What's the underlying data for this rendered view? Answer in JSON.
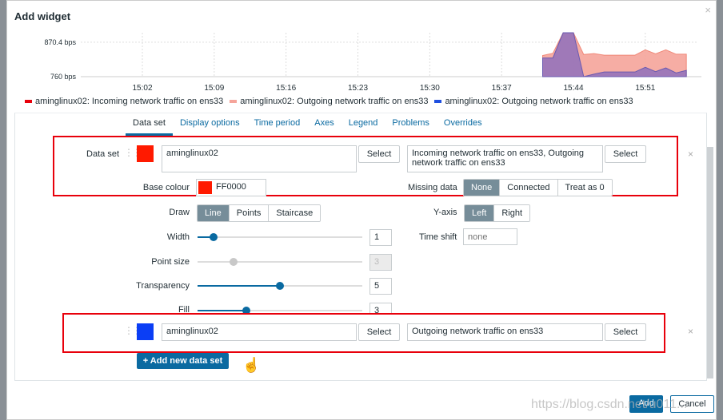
{
  "dialog": {
    "title": "Add widget",
    "close_icon": "close-icon"
  },
  "chart_data": {
    "type": "area",
    "y_ticks": [
      "870.4 bps",
      "760 bps"
    ],
    "x_ticks": [
      "15:02",
      "15:09",
      "15:16",
      "15:23",
      "15:30",
      "15:37",
      "15:44",
      "15:51"
    ],
    "ylim": [
      760,
      901
    ],
    "xlim": [
      "14:56",
      "15:56"
    ],
    "grid": true,
    "legend_placement": "bottom",
    "series": [
      {
        "name": "aminglinux02: Outgoing network traffic on ens33",
        "color": "#f5a49a",
        "x": [
          "15:41",
          "15:42",
          "15:43",
          "15:44",
          "15:45",
          "15:46",
          "15:47",
          "15:48",
          "15:49",
          "15:50",
          "15:51",
          "15:52",
          "15:53",
          "15:54",
          "15:55"
        ],
        "values": [
          828,
          835,
          901,
          901,
          831,
          834,
          829,
          829,
          829,
          829,
          846,
          833,
          846,
          832,
          832
        ]
      },
      {
        "name": "aminglinux02: Outgoing network traffic on ens33",
        "color": "#8a6bbd",
        "x": [
          "15:41",
          "15:42",
          "15:43",
          "15:44",
          "15:45",
          "15:46",
          "15:47",
          "15:48",
          "15:49",
          "15:50",
          "15:51",
          "15:52",
          "15:53",
          "15:54",
          "15:55"
        ],
        "values": [
          820,
          820,
          901,
          901,
          760,
          768,
          775,
          775,
          775,
          775,
          790,
          776,
          788,
          772,
          780
        ]
      }
    ],
    "legend": [
      {
        "label": "aminglinux02: Incoming network traffic on ens33",
        "color": "#e8000b"
      },
      {
        "label": "aminglinux02: Outgoing network traffic on ens33",
        "color": "#f5a49a"
      },
      {
        "label": "aminglinux02: Outgoing network traffic on ens33",
        "color": "#1f4fe0"
      }
    ]
  },
  "tabs": [
    "Data set",
    "Display options",
    "Time period",
    "Axes",
    "Legend",
    "Problems",
    "Overrides"
  ],
  "dataset1": {
    "label": "Data set",
    "color": "#ff1a00",
    "host": "aminglinux02",
    "select": "Select",
    "items": "Incoming network traffic on ens33, Outgoing network traffic on ens33",
    "base_colour_label": "Base colour",
    "base_colour": "FF0000",
    "missing_label": "Missing data",
    "missing_options": [
      "None",
      "Connected",
      "Treat as 0"
    ],
    "missing_selected": "None"
  },
  "options": {
    "draw_label": "Draw",
    "draw_options": [
      "Line",
      "Points",
      "Staircase"
    ],
    "draw_selected": "Line",
    "yaxis_label": "Y-axis",
    "yaxis_options": [
      "Left",
      "Right"
    ],
    "yaxis_selected": "Left",
    "width_label": "Width",
    "width": "1",
    "timeshift_label": "Time shift",
    "timeshift_placeholder": "none",
    "pointsize_label": "Point size",
    "pointsize": "3",
    "transparency_label": "Transparency",
    "transparency": "5",
    "fill_label": "Fill",
    "fill": "3"
  },
  "dataset2": {
    "color": "#0b3ef5",
    "host": "aminglinux02",
    "select": "Select",
    "items": "Outgoing network traffic on ens33"
  },
  "add_dataset": "+ Add new data set",
  "footer": {
    "add": "Add",
    "cancel": "Cancel"
  },
  "watermark": "https://blog.csdn.net/u011..."
}
